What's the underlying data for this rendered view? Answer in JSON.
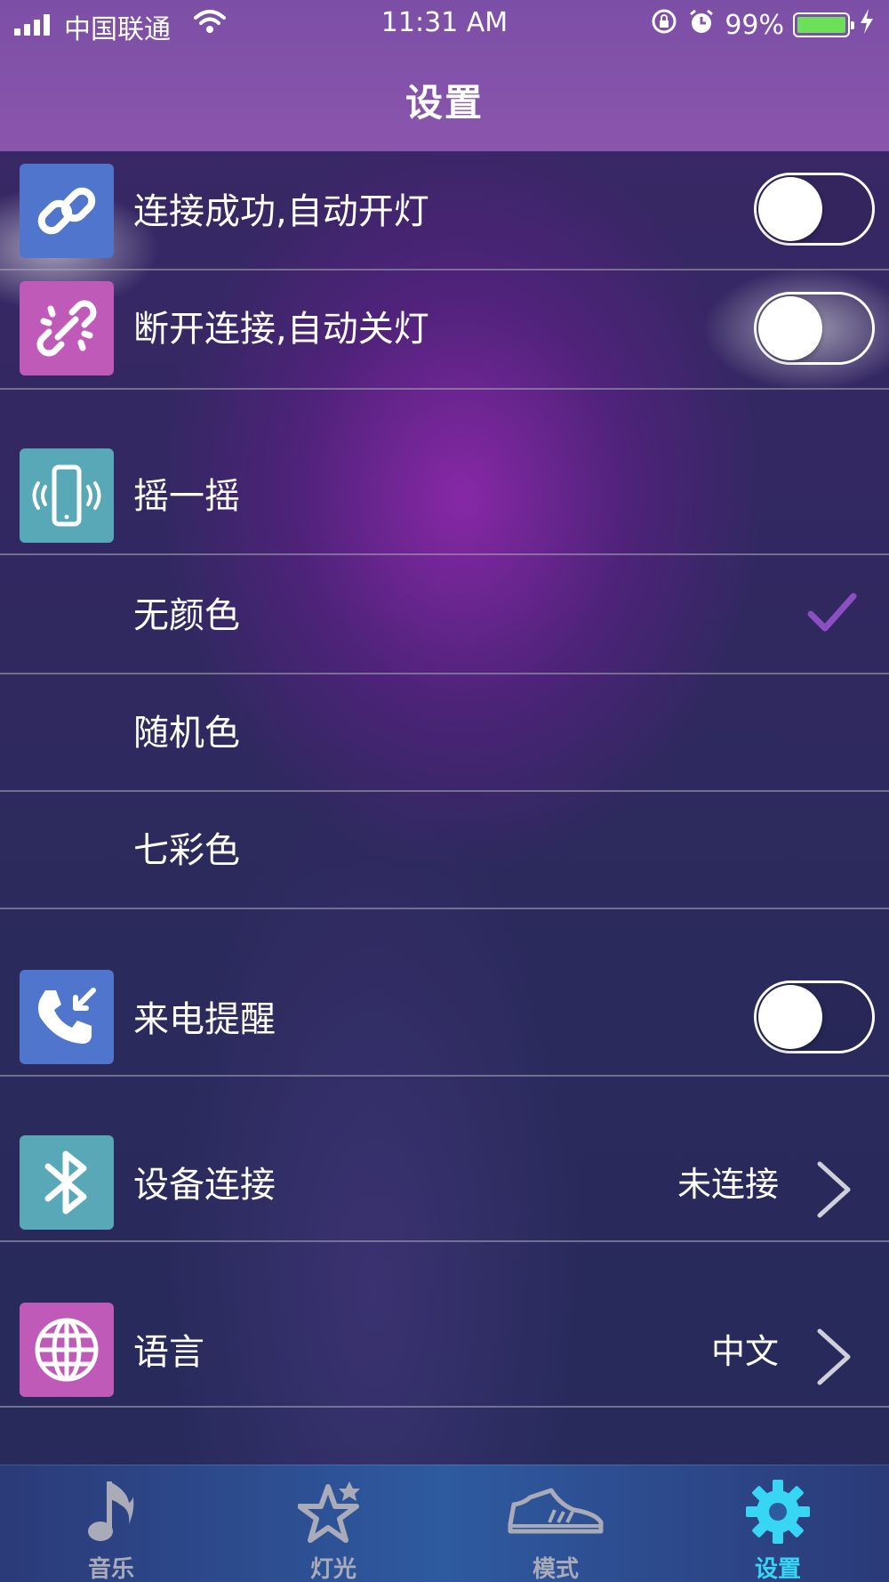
{
  "status_bar": {
    "carrier": "中国联通",
    "time": "11:31 AM",
    "battery": "99%"
  },
  "nav": {
    "title": "设置"
  },
  "settings": {
    "auto_on": {
      "label": "连接成功,自动开灯",
      "enabled": false
    },
    "auto_off": {
      "label": "断开连接,自动关灯",
      "enabled": false
    },
    "shake": {
      "label": "摇一摇"
    },
    "shake_options": [
      {
        "label": "无颜色",
        "selected": true
      },
      {
        "label": "随机色",
        "selected": false
      },
      {
        "label": "七彩色",
        "selected": false
      }
    ],
    "call_alert": {
      "label": "来电提醒",
      "enabled": false
    },
    "device": {
      "label": "设备连接",
      "value": "未连接"
    },
    "language": {
      "label": "语言",
      "value": "中文"
    }
  },
  "tabs": [
    {
      "label": "音乐",
      "icon": "music-note-icon",
      "active": false
    },
    {
      "label": "灯光",
      "icon": "star-icon",
      "active": false
    },
    {
      "label": "模式",
      "icon": "shoe-icon",
      "active": false
    },
    {
      "label": "设置",
      "icon": "gear-icon",
      "active": true
    }
  ],
  "colors": {
    "accent_active_tab": "#38d6f5",
    "checkmark": "#8a4fc0",
    "icon_blue": "#4f75cc",
    "icon_pink": "#c05ab8",
    "icon_teal": "#58a8b8"
  }
}
